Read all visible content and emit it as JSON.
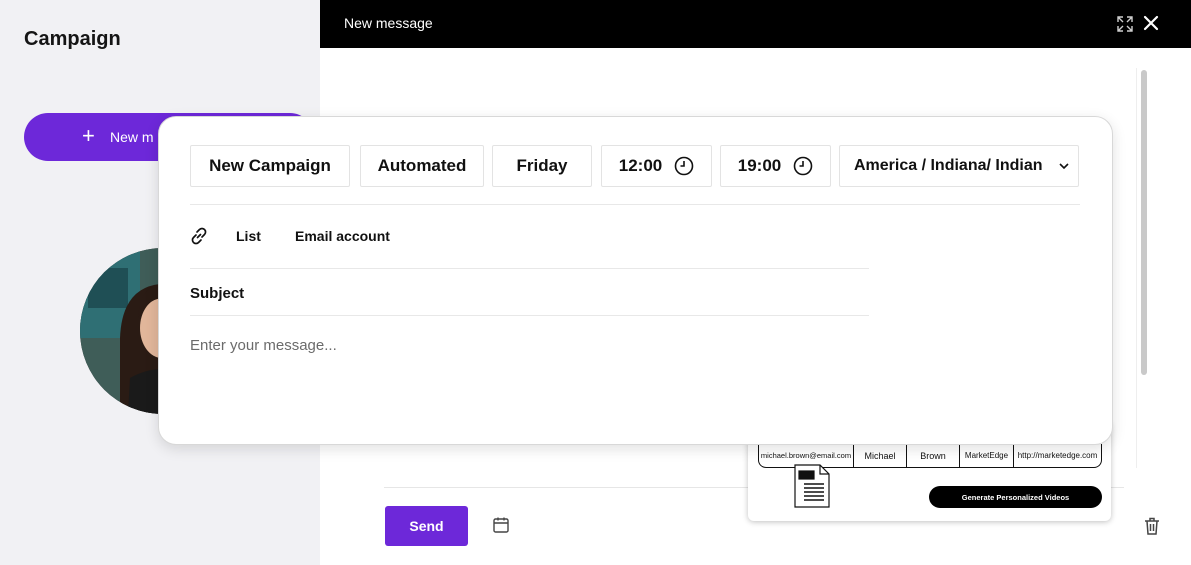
{
  "sidebar": {
    "title": "Campaign",
    "new_message_label": "New m"
  },
  "compose": {
    "title": "New message",
    "send_label": "Send"
  },
  "campaign_bar": {
    "name": "New Campaign",
    "mode": "Automated",
    "day": "Friday",
    "start_time": "12:00",
    "end_time": "19:00",
    "timezone": "America / Indiana/ Indian"
  },
  "recipients": {
    "list_label": "List",
    "email_account_label": "Email account"
  },
  "subject": {
    "label": "Subject"
  },
  "message": {
    "placeholder": "Enter your message..."
  },
  "csv_preview": {
    "cells": [
      "michael.brown@email.com",
      "Michael",
      "Brown",
      "MarketEdge",
      "http://marketedge.com"
    ],
    "file_badge": "CSV",
    "generate_label": "Generate Personalized Videos"
  },
  "colors": {
    "accent": "#6d28d9",
    "header_bg": "#000000",
    "sidebar_bg": "#f1f1f4"
  },
  "icons": [
    "plus-icon",
    "expand-icon",
    "close-icon",
    "clock-icon",
    "chevron-down-icon",
    "link-icon",
    "calendar-icon",
    "trash-icon",
    "csv-file-icon"
  ]
}
